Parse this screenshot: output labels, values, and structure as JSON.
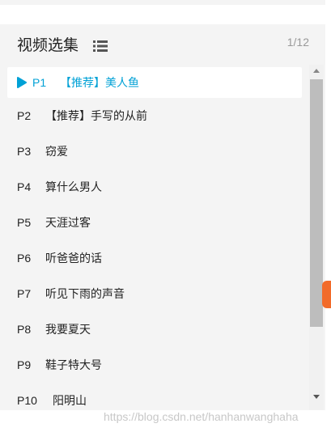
{
  "header": {
    "title": "视频选集",
    "counter": "1/12"
  },
  "episodes": [
    {
      "num": "P1",
      "name": "【推荐】美人鱼",
      "active": true
    },
    {
      "num": "P2",
      "name": "【推荐】手写的从前",
      "active": false
    },
    {
      "num": "P3",
      "name": "窃爱",
      "active": false
    },
    {
      "num": "P4",
      "name": "算什么男人",
      "active": false
    },
    {
      "num": "P5",
      "name": "天涯过客",
      "active": false
    },
    {
      "num": "P6",
      "name": "听爸爸的话",
      "active": false
    },
    {
      "num": "P7",
      "name": "听见下雨的声音",
      "active": false
    },
    {
      "num": "P8",
      "name": "我要夏天",
      "active": false
    },
    {
      "num": "P9",
      "name": "鞋子特大号",
      "active": false
    },
    {
      "num": "P10",
      "name": "阳明山",
      "active": false
    }
  ],
  "icons": {
    "list": "list-icon",
    "play": "play-icon"
  },
  "colors": {
    "accent": "#00a1d6",
    "panel_bg": "#f4f4f4",
    "peek_orange": "#f26b2a"
  },
  "watermark": "https://blog.csdn.net/hanhanwanghaha"
}
